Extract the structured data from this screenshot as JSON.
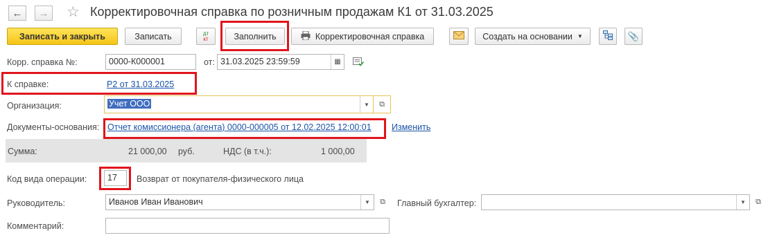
{
  "window": {
    "title": "Корректировочная справка по розничным продажам К1 от 31.03.2025"
  },
  "toolbar": {
    "save_close": "Записать и закрыть",
    "save": "Записать",
    "dt_kt_top": "дт",
    "dt_kt_bottom": "кт",
    "fill": "Заполнить",
    "print_label": "Корректировочная справка",
    "create_based": "Создать на основании"
  },
  "form": {
    "corr_number_label": "Корр. справка №:",
    "corr_number": "0000-К000001",
    "date_label": "от:",
    "date": "31.03.2025 23:59:59",
    "ref_label": "К справке:",
    "ref_link": "Р2 от 31.03.2025",
    "org_label": "Организация:",
    "org_value": "Учет ООО",
    "base_docs_label": "Документы-основания:",
    "base_docs_link": "Отчет комиссионера (агента) 0000-000005 от 12.02.2025 12:00:01",
    "change_link": "Изменить",
    "sum_label": "Сумма:",
    "sum_value": "21 000,00",
    "currency": "руб.",
    "vat_label": "НДС (в т.ч.):",
    "vat_value": "1 000,00",
    "op_code_label": "Код вида операции:",
    "op_code": "17",
    "op_code_desc": "Возврат от покупателя-физического лица",
    "director_label": "Руководитель:",
    "director": "Иванов Иван Иванович",
    "accountant_label": "Главный бухгалтер:",
    "accountant": "",
    "comment_label": "Комментарий:",
    "comment": ""
  },
  "colors": {
    "highlight_frame": "#e0141c",
    "primary_button": "#f5c518",
    "link": "#1a53a8",
    "selection": "#3f6dbf"
  }
}
